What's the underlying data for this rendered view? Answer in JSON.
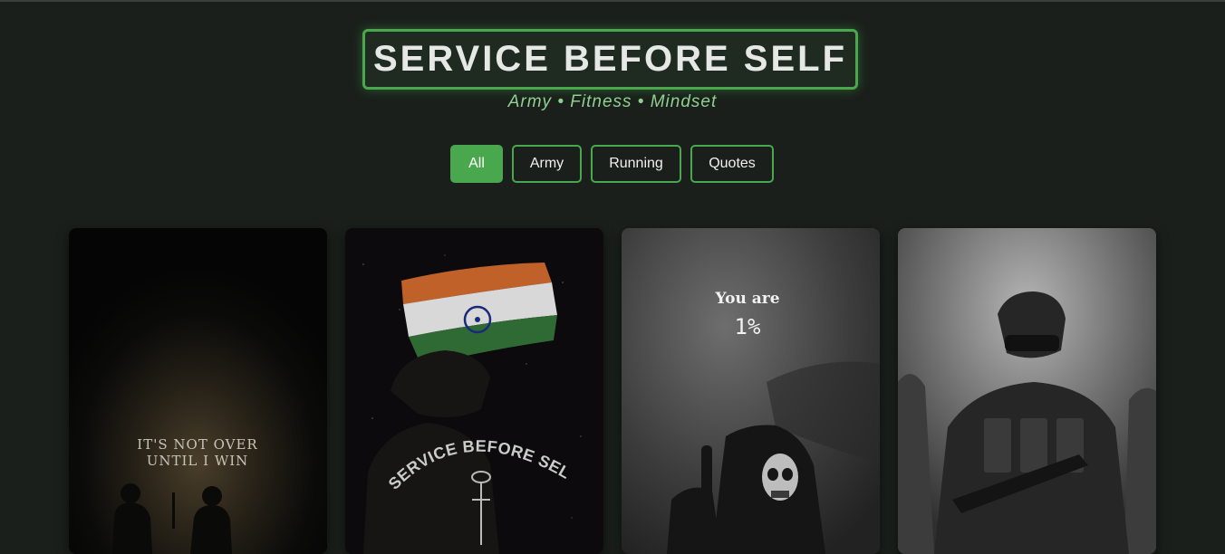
{
  "header": {
    "title": "SERVICE BEFORE SELF",
    "subtitle": "Army • Fitness • Mindset"
  },
  "filters": [
    {
      "label": "All",
      "active": true
    },
    {
      "label": "Army",
      "active": false
    },
    {
      "label": "Running",
      "active": false
    },
    {
      "label": "Quotes",
      "active": false
    }
  ],
  "gallery": {
    "cards": [
      {
        "text_line1": "IT'S NOT OVER",
        "text_line2": "UNTIL I WIN"
      },
      {
        "text": "SERVICE BEFORE SELF"
      },
      {
        "text_line1": "You are",
        "text_line2": "1%"
      },
      {}
    ]
  },
  "colors": {
    "background": "#1a1f1b",
    "accent": "#49a84d",
    "subtitle": "#8fd08f"
  }
}
